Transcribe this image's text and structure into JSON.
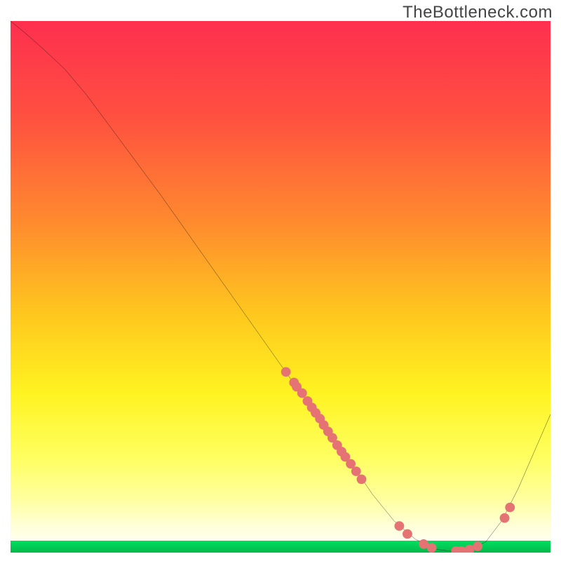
{
  "watermark": "TheBottleneck.com",
  "chart_data": {
    "type": "line",
    "title": "",
    "xlabel": "",
    "ylabel": "",
    "xlim": [
      0,
      100
    ],
    "ylim": [
      0,
      100
    ],
    "gradient_stops": [
      {
        "offset": 0,
        "color": "#fe2f4f"
      },
      {
        "offset": 18,
        "color": "#ff5040"
      },
      {
        "offset": 38,
        "color": "#ff8b2e"
      },
      {
        "offset": 55,
        "color": "#ffc71e"
      },
      {
        "offset": 70,
        "color": "#fff321"
      },
      {
        "offset": 82,
        "color": "#ffff60"
      },
      {
        "offset": 90,
        "color": "#ffffa0"
      },
      {
        "offset": 95,
        "color": "#ffffd8"
      },
      {
        "offset": 100,
        "color": "#ffffff"
      }
    ],
    "green_band": {
      "color_top": "#00e060",
      "color_bottom": "#00b84a",
      "height_pct": 2.2
    },
    "series": [
      {
        "name": "bottleneck-curve",
        "type": "line",
        "color": "#000000",
        "points": [
          {
            "x": 0.0,
            "y": 100.0
          },
          {
            "x": 3.0,
            "y": 97.5
          },
          {
            "x": 6.0,
            "y": 94.8
          },
          {
            "x": 10.0,
            "y": 91.0
          },
          {
            "x": 14.0,
            "y": 86.2
          },
          {
            "x": 20.0,
            "y": 78.0
          },
          {
            "x": 28.0,
            "y": 67.0
          },
          {
            "x": 36.0,
            "y": 55.5
          },
          {
            "x": 44.0,
            "y": 44.0
          },
          {
            "x": 52.0,
            "y": 32.5
          },
          {
            "x": 58.0,
            "y": 24.0
          },
          {
            "x": 63.0,
            "y": 17.0
          },
          {
            "x": 67.0,
            "y": 11.0
          },
          {
            "x": 71.0,
            "y": 6.0
          },
          {
            "x": 75.0,
            "y": 2.5
          },
          {
            "x": 79.0,
            "y": 0.6
          },
          {
            "x": 82.0,
            "y": 0.2
          },
          {
            "x": 85.0,
            "y": 0.6
          },
          {
            "x": 88.0,
            "y": 2.0
          },
          {
            "x": 91.0,
            "y": 6.0
          },
          {
            "x": 94.0,
            "y": 12.0
          },
          {
            "x": 97.0,
            "y": 19.0
          },
          {
            "x": 100.0,
            "y": 26.0
          }
        ]
      },
      {
        "name": "data-markers",
        "type": "scatter",
        "color": "#e57373",
        "points": [
          {
            "x": 51.0,
            "y": 34.0
          },
          {
            "x": 52.5,
            "y": 32.0
          },
          {
            "x": 53.0,
            "y": 31.2
          },
          {
            "x": 54.0,
            "y": 30.0
          },
          {
            "x": 55.0,
            "y": 28.5
          },
          {
            "x": 55.8,
            "y": 27.3
          },
          {
            "x": 56.5,
            "y": 26.3
          },
          {
            "x": 57.3,
            "y": 25.2
          },
          {
            "x": 58.0,
            "y": 24.0
          },
          {
            "x": 58.8,
            "y": 22.8
          },
          {
            "x": 59.6,
            "y": 21.6
          },
          {
            "x": 60.5,
            "y": 20.2
          },
          {
            "x": 61.3,
            "y": 19.0
          },
          {
            "x": 62.0,
            "y": 18.0
          },
          {
            "x": 63.0,
            "y": 16.7
          },
          {
            "x": 64.0,
            "y": 15.3
          },
          {
            "x": 65.0,
            "y": 13.8
          },
          {
            "x": 72.0,
            "y": 5.0
          },
          {
            "x": 73.5,
            "y": 3.5
          },
          {
            "x": 76.5,
            "y": 1.6
          },
          {
            "x": 78.0,
            "y": 0.9
          },
          {
            "x": 82.5,
            "y": 0.3
          },
          {
            "x": 83.5,
            "y": 0.3
          },
          {
            "x": 85.0,
            "y": 0.6
          },
          {
            "x": 86.5,
            "y": 1.2
          },
          {
            "x": 91.5,
            "y": 6.5
          },
          {
            "x": 92.5,
            "y": 8.5
          }
        ]
      }
    ]
  }
}
